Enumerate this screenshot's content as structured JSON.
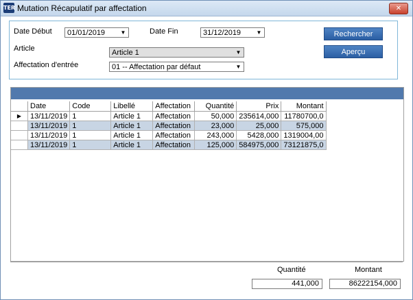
{
  "window": {
    "title": "Mutation Récapulatif par affectation",
    "app_icon_text": "TER",
    "close_glyph": "✕"
  },
  "filters": {
    "date_debut_label": "Date Début",
    "date_debut_value": "01/01/2019",
    "date_fin_label": "Date Fin",
    "date_fin_value": "31/12/2019",
    "article_label": "Article",
    "article_value": "Article 1",
    "affectation_label": "Affectation d'entrée",
    "affectation_value": "01 -- Affectation par défaut"
  },
  "buttons": {
    "rechercher": "Rechercher",
    "apercu": "Aperçu"
  },
  "grid": {
    "columns": [
      "Date",
      "Code",
      "Libellé",
      "Affectation",
      "Quantité",
      "Prix",
      "Montant"
    ],
    "rows": [
      [
        "13/11/2019",
        "1",
        "Article 1",
        "Affectation",
        "50,000",
        "235614,000",
        "11780700,0"
      ],
      [
        "13/11/2019",
        "1",
        "Article 1",
        "Affectation",
        "23,000",
        "25,000",
        "575,000"
      ],
      [
        "13/11/2019",
        "1",
        "Article 1",
        "Affectation",
        "243,000",
        "5428,000",
        "1319004,00"
      ],
      [
        "13/11/2019",
        "1",
        "Article 1",
        "Affectation",
        "125,000",
        "584975,000",
        "73121875,0"
      ]
    ],
    "current_row_marker": "▶"
  },
  "totals": {
    "quantite_label": "Quantité",
    "quantite_value": "441,000",
    "montant_label": "Montant",
    "montant_value": "86222154,000"
  },
  "icons": {
    "dropdown": "chevron-down-icon",
    "close": "close-icon",
    "row-pointer": "row-pointer-icon"
  },
  "colors": {
    "button": "#3569ad",
    "grid_header_bar": "#5179ad",
    "alt_row": "#c8d5e4",
    "panel_border": "#7fb6d8"
  }
}
